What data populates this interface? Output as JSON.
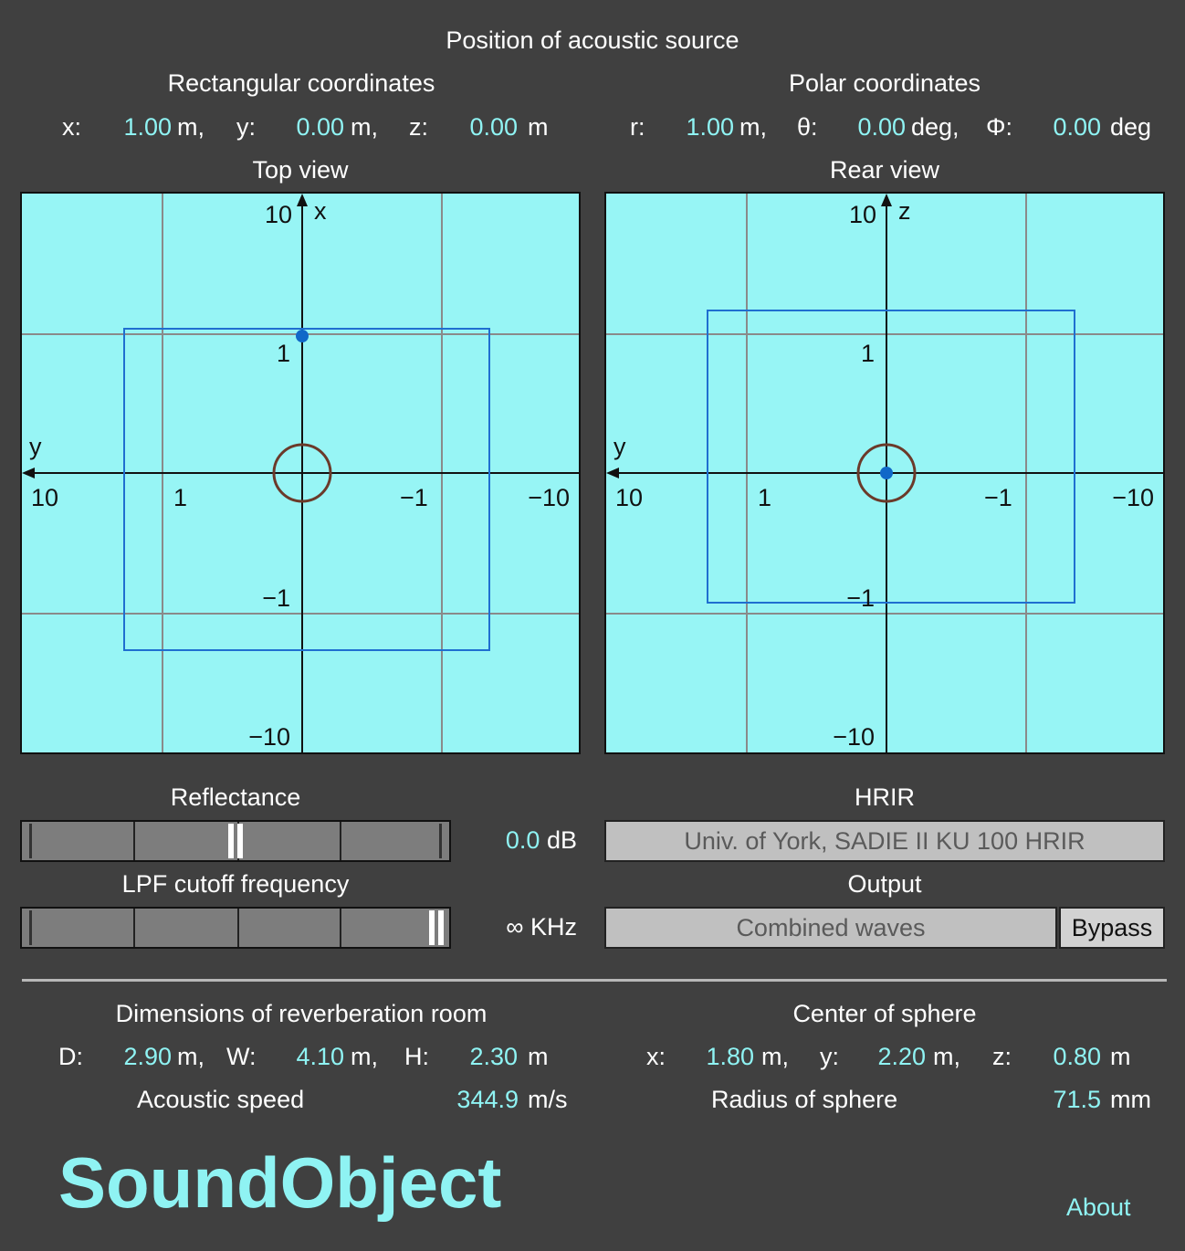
{
  "title": "Position of acoustic source",
  "rect": {
    "heading": "Rectangular coordinates",
    "x_label": "x:",
    "x_val": "1.00",
    "x_unit": "m,",
    "y_label": "y:",
    "y_val": "0.00",
    "y_unit": "m,",
    "z_label": "z:",
    "z_val": "0.00",
    "z_unit": "m"
  },
  "polar": {
    "heading": "Polar coordinates",
    "r_label": "r:",
    "r_val": "1.00",
    "r_unit": "m,",
    "t_label": "θ:",
    "t_val": "0.00",
    "t_unit": "deg,",
    "p_label": "Φ:",
    "p_val": "0.00",
    "p_unit": "deg"
  },
  "top_view": {
    "heading": "Top view",
    "v_axis": "x",
    "h_axis": "y",
    "tick_top": "10",
    "tick_1": "1",
    "tick_m1": "−1",
    "tick_bottom": "−10",
    "tick_left": "10",
    "tick_l1": "1",
    "tick_r1": "−1",
    "tick_right": "−10"
  },
  "rear_view": {
    "heading": "Rear view",
    "v_axis": "z",
    "h_axis": "y",
    "tick_top": "10",
    "tick_1": "1",
    "tick_m1": "−1",
    "tick_bottom": "−10",
    "tick_left": "10",
    "tick_l1": "1",
    "tick_r1": "−1",
    "tick_right": "−10"
  },
  "plot_colors": {
    "background": "#97f5f5",
    "room": "#1f6fd0",
    "source": "#1068c8",
    "head": "#6b3a2a"
  },
  "reflectance": {
    "label": "Reflectance",
    "value": "0.0",
    "unit": "dB",
    "level": 0.5
  },
  "lpf": {
    "label": "LPF cutoff frequency",
    "value": "∞",
    "unit": "KHz",
    "level": 1.0
  },
  "hrir": {
    "label": "HRIR",
    "value": "Univ. of York, SADIE II KU 100 HRIR"
  },
  "output": {
    "label": "Output",
    "value": "Combined waves",
    "bypass": "Bypass"
  },
  "room": {
    "heading": "Dimensions of reverberation room",
    "d_label": "D:",
    "d_val": "2.90",
    "d_unit": "m,",
    "w_label": "W:",
    "w_val": "4.10",
    "w_unit": "m,",
    "h_label": "H:",
    "h_val": "2.30",
    "h_unit": "m",
    "speed_label": "Acoustic speed",
    "speed_val": "344.9",
    "speed_unit": "m/s"
  },
  "sphere": {
    "heading": "Center of sphere",
    "x_label": "x:",
    "x_val": "1.80",
    "x_unit": "m,",
    "y_label": "y:",
    "y_val": "2.20",
    "y_unit": "m,",
    "z_label": "z:",
    "z_val": "0.80",
    "z_unit": "m",
    "radius_label": "Radius of sphere",
    "radius_val": "71.5",
    "radius_unit": "mm"
  },
  "logo": "SoundObject",
  "about": "About"
}
